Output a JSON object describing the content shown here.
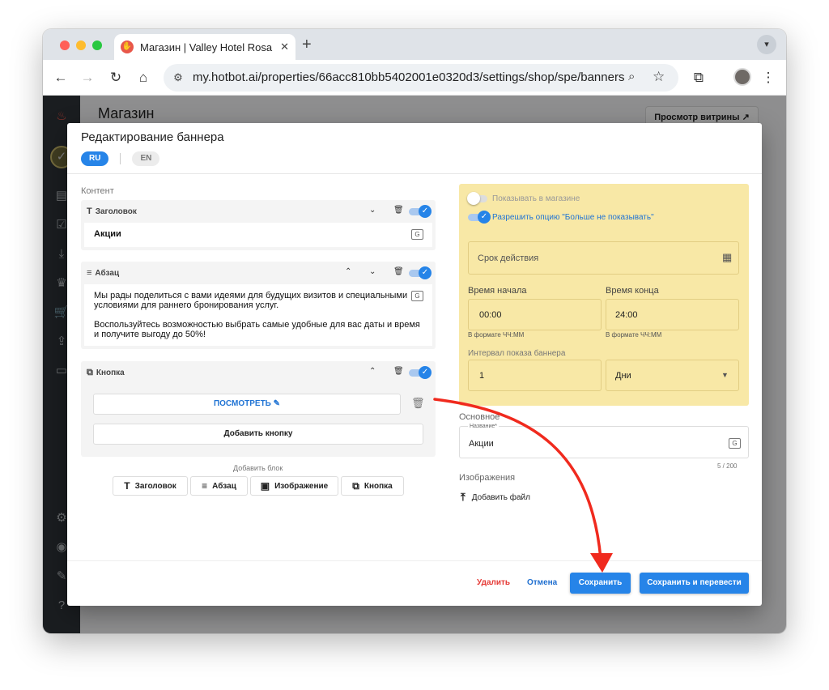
{
  "browser": {
    "tab_title": "Магазин | Valley Hotel Rosa K",
    "url": "my.hotbot.ai/properties/66acc810bb5402001e0320d3/settings/shop/spe/banners"
  },
  "app": {
    "page_title": "Магазин",
    "storefront_button": "Просмотр витрины ↗"
  },
  "modal": {
    "title": "Редактирование баннера",
    "languages": [
      "RU",
      "EN"
    ],
    "active_language": "RU",
    "content_label": "Контент",
    "blocks": {
      "heading": {
        "label": "Заголовок",
        "text": "Акции"
      },
      "paragraph": {
        "label": "Абзац",
        "line1": "Мы рады поделиться с вами идеями для будущих визитов и специальными",
        "line2": "условиями для раннего бронирования услуг.",
        "line3": "Воспользуйтесь возможностью выбрать самые удобные для вас даты и время",
        "line4": "и получите выгоду до 50%!"
      },
      "button": {
        "label": "Кнопка",
        "view_button": "ПОСМОТРЕТЬ",
        "add_button": "Добавить кнопку"
      }
    },
    "add_block": {
      "label": "Добавить блок",
      "options": [
        "Заголовок",
        "Абзац",
        "Изображение",
        "Кнопка"
      ]
    },
    "settings": {
      "show_in_shop": {
        "label": "Показывать в магазине",
        "enabled": false
      },
      "allow_dont_show": {
        "label": "Разрешить опцию \"Больше не показывать\"",
        "enabled": true
      },
      "validity_placeholder": "Срок действия",
      "start_time": {
        "label": "Время начала",
        "value": "00:00",
        "hint": "В формате ЧЧ:ММ"
      },
      "end_time": {
        "label": "Время конца",
        "value": "24:00",
        "hint": "В формате ЧЧ:ММ"
      },
      "interval": {
        "label": "Интервал показа баннера",
        "value": "1",
        "unit": "Дни"
      }
    },
    "main": {
      "label": "Основное",
      "name_label": "Название*",
      "name_value": "Акции",
      "counter": "5 / 200"
    },
    "images": {
      "label": "Изображения",
      "add_file": "Добавить файл"
    },
    "footer": {
      "delete": "Удалить",
      "cancel": "Отмена",
      "save": "Сохранить",
      "save_translate": "Сохранить и перевести"
    }
  },
  "colors": {
    "accent": "#2684e8",
    "danger": "#e53935",
    "panel_yellow": "#f8e8a6",
    "annotation_arrow": "#f02a1e"
  },
  "icons": [
    "back-icon",
    "forward-icon",
    "reload-icon",
    "home-icon",
    "zoom-icon",
    "star-icon",
    "extensions-icon",
    "menu-icon",
    "trash-icon",
    "chevron-up-icon",
    "chevron-down-icon",
    "pencil-icon",
    "calendar-icon",
    "upload-icon",
    "translate-icon"
  ]
}
